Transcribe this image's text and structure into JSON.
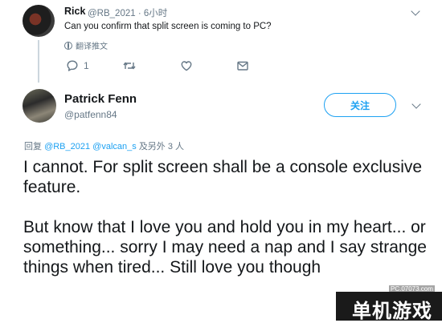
{
  "reply": {
    "author_name": "Rick",
    "author_handle": "@RB_2021 · 6小时",
    "text": "Can you confirm that split screen is coming to PC?",
    "translate_label": "翻译推文",
    "reply_count": "1",
    "icons": [
      "comment-icon",
      "retweet-icon",
      "like-icon",
      "message-icon",
      "chevron-down-icon"
    ]
  },
  "tweet": {
    "author_name": "Patrick Fenn",
    "author_handle": "@patfenn84",
    "follow_label": "关注",
    "replying_prefix": "回复",
    "replying_mentions": "@RB_2021 @valcan_s",
    "replying_suffix": "及另外 3 人",
    "text": "I cannot. For split screen shall be a console exclusive feature.\n\nBut know that I love you and hold you in my heart... or something... sorry  I may need a nap and I say strange things when tired... Still love you though",
    "icons": [
      "chevron-down-icon"
    ]
  },
  "watermark": {
    "site": "PC.07073.com",
    "logo_text": "单机游戏"
  },
  "colors": {
    "accent": "#1da1f2",
    "secondary_text": "#657786",
    "primary_text": "#14171a"
  }
}
